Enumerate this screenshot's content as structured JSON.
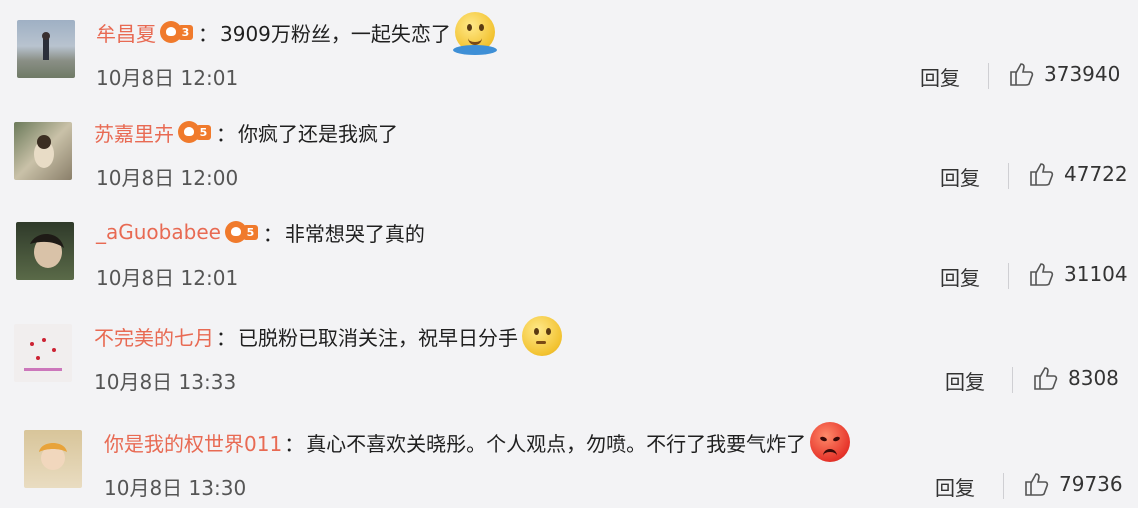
{
  "comments": [
    {
      "username": "牟昌夏",
      "separator": "：",
      "text": "3909万粉丝，一起失恋了",
      "emoji": "smile-wave-emoji",
      "time": "10月8日 12:01",
      "reply_label": "回复",
      "likes": "373940",
      "level": "3"
    },
    {
      "username": "苏嘉里卉",
      "separator": "：",
      "text": "你疯了还是我疯了",
      "emoji": "",
      "time": "10月8日 12:00",
      "reply_label": "回复",
      "likes": "47722",
      "level": "5"
    },
    {
      "username": "_aGuobabee",
      "separator": "：",
      "text": "非常想哭了真的",
      "emoji": "",
      "time": "10月8日 12:01",
      "reply_label": "回复",
      "likes": "31104",
      "level": "5"
    },
    {
      "username": "不完美的七月",
      "separator": "：",
      "text": "已脱粉已取消关注，祝早日分手",
      "emoji": "sly-smile-emoji",
      "time": "10月8日 13:33",
      "reply_label": "回复",
      "likes": "8308",
      "level": ""
    },
    {
      "username": "你是我的权世界011",
      "separator": "：",
      "text": "真心不喜欢关晓彤。个人观点，勿喷。不行了我要气炸了",
      "emoji": "angry-emoji",
      "time": "10月8日 13:30",
      "reply_label": "回复",
      "likes": "79736",
      "level": ""
    }
  ]
}
